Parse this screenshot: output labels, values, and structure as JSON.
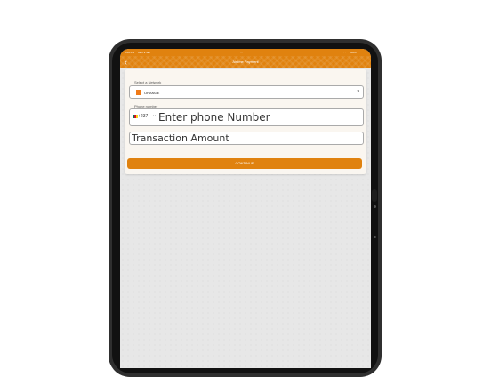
{
  "status_bar": {
    "time": "5:09 PM",
    "date": "Mon 9 Jan",
    "signal": "···",
    "wifi": "wifi-icon",
    "battery": "100%"
  },
  "nav": {
    "back_icon": "chevron-left-icon",
    "title": "Airtime Payment"
  },
  "network": {
    "label": "Select a Network",
    "selected": "ORANGE",
    "icon": "orange-logo",
    "icon_color": "#f07a17"
  },
  "phone": {
    "label": "Phone number",
    "country_code": "+237",
    "placeholder": "Enter phone Number"
  },
  "amount": {
    "placeholder": "Transaction Amount"
  },
  "continue_label": "CONTINUE",
  "colors": {
    "brand": "#e0820f",
    "card": "#faf6f0",
    "background": "#e7e7e7"
  }
}
